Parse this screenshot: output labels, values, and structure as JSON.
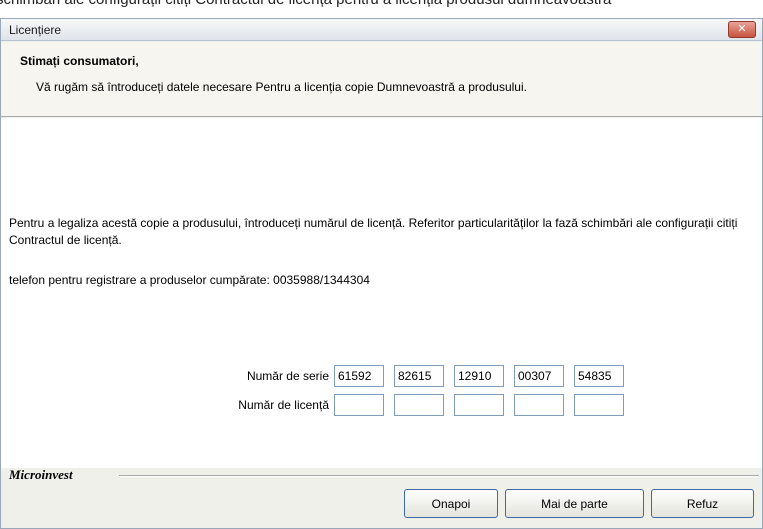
{
  "caption": "schimbări ale configurații citiți Contractul de licență pentru a licenția produsul dumneavoastră",
  "window": {
    "title": "Licențiere",
    "close_glyph": "✕"
  },
  "header": {
    "title": "Stimați consumatori,",
    "subtitle": "Vă rugăm să întroduceți datele necesare Pentru a licenția copie Dumnevoastră a produsului."
  },
  "body": {
    "paragraph": "Pentru a legaliza acestă copie a produsului, întroduceți numărul de licență. Referitor particularităților la fază schimbări ale configurații citiți Contractul de licență.",
    "phone_line": "telefon pentru registrare a produselor cumpărate: 0035988/1344304"
  },
  "serial": {
    "label": "Număr de serie",
    "values": [
      "61592",
      "82615",
      "12910",
      "00307",
      "54835"
    ]
  },
  "license": {
    "label": "Număr de licență",
    "values": [
      "",
      "",
      "",
      "",
      ""
    ]
  },
  "footer": {
    "brand": "Microinvest",
    "back_label": "Onapoi",
    "next_label": "Mai de parte",
    "refuse_label": "Refuz"
  }
}
